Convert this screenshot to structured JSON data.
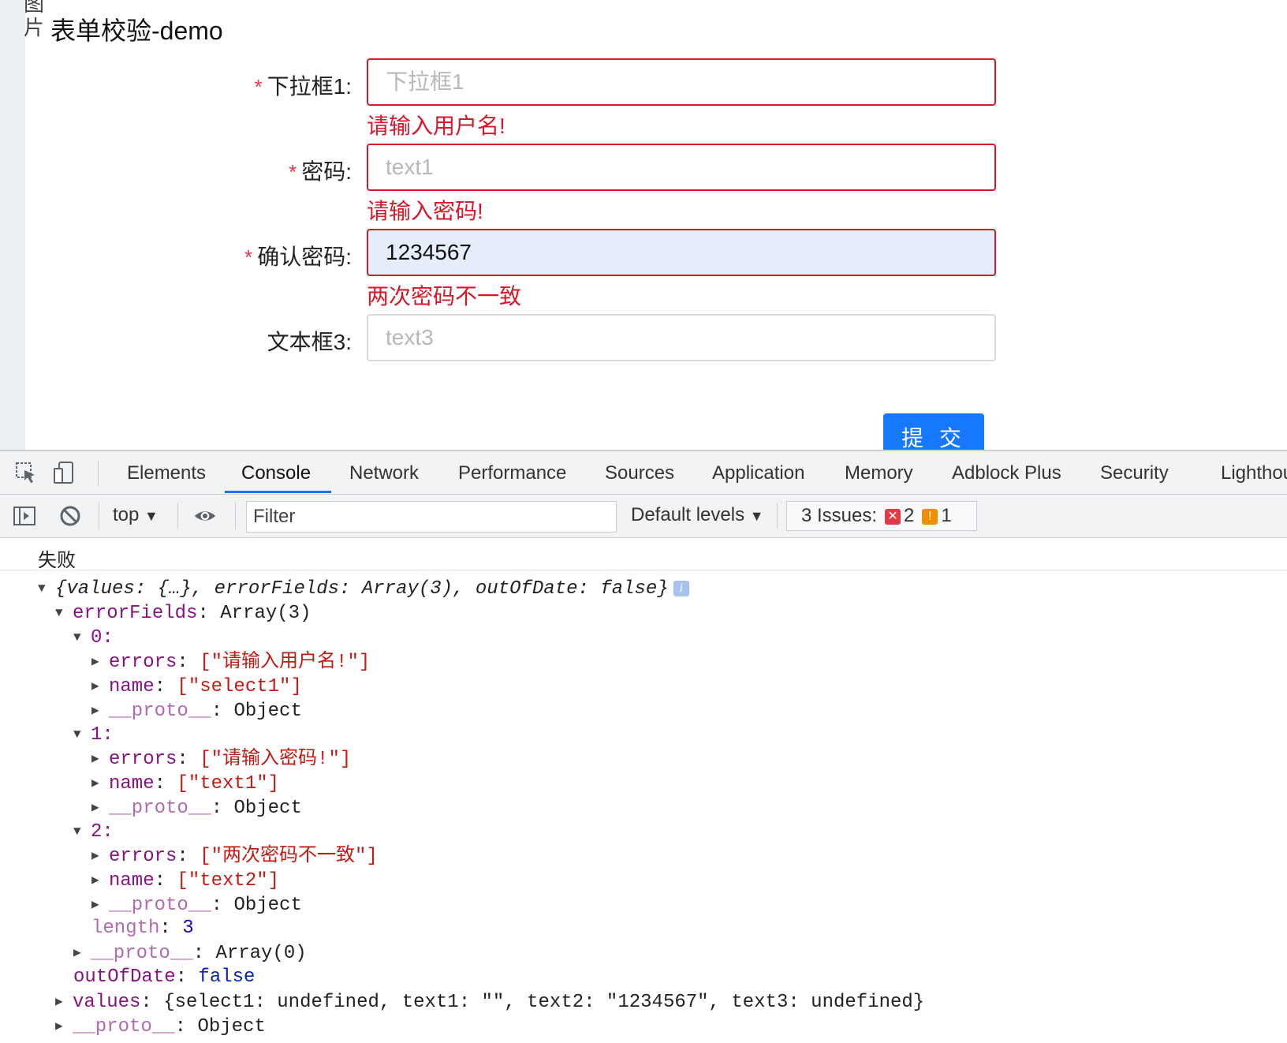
{
  "page": {
    "broken_image_alt": "图片",
    "title": "表单校验-demo"
  },
  "form": {
    "fields": [
      {
        "label": "下拉框1:",
        "required": "*",
        "placeholder": "下拉框1",
        "value": "",
        "error": "请输入用户名!"
      },
      {
        "label": "密码:",
        "required": "*",
        "placeholder": "text1",
        "value": "",
        "error": "请输入密码!"
      },
      {
        "label": "确认密码:",
        "required": "*",
        "placeholder": "",
        "value": "1234567",
        "error": "两次密码不一致"
      },
      {
        "label": "文本框3:",
        "required": "",
        "placeholder": "text3",
        "value": "",
        "error": ""
      }
    ],
    "submit_label": "提 交"
  },
  "devtools": {
    "tabs": [
      "Elements",
      "Console",
      "Network",
      "Performance",
      "Sources",
      "Application",
      "Memory",
      "Adblock Plus",
      "Security",
      "Lighthou"
    ],
    "active_tab": "Console",
    "accent_color": "#1a73e8",
    "toolbar": {
      "context": "top",
      "filter_placeholder": "Filter",
      "levels": "Default levels",
      "issues_label": "3 Issues:",
      "issues_errors": "2",
      "issues_warnings": "1"
    }
  },
  "console": {
    "log_message": "失败",
    "summary": "{values: {…}, errorFields: Array(3), outOfDate: false}",
    "error_fields_label": "errorFields",
    "error_fields_type": "Array(3)",
    "entries": [
      {
        "index": "0",
        "errors": "[\"请输入用户名!\"]",
        "name": "[\"select1\"]",
        "proto": "Object"
      },
      {
        "index": "1",
        "errors": "[\"请输入密码!\"]",
        "name": "[\"text1\"]",
        "proto": "Object"
      },
      {
        "index": "2",
        "errors": "[\"两次密码不一致\"]",
        "name": "[\"text2\"]",
        "proto": "Object"
      }
    ],
    "length": "3",
    "array_proto": "Array(0)",
    "out_of_date": "false",
    "values_line": "{select1: undefined, text1: \"\", text2: \"1234567\", text3: undefined}",
    "last_proto": "Object"
  }
}
